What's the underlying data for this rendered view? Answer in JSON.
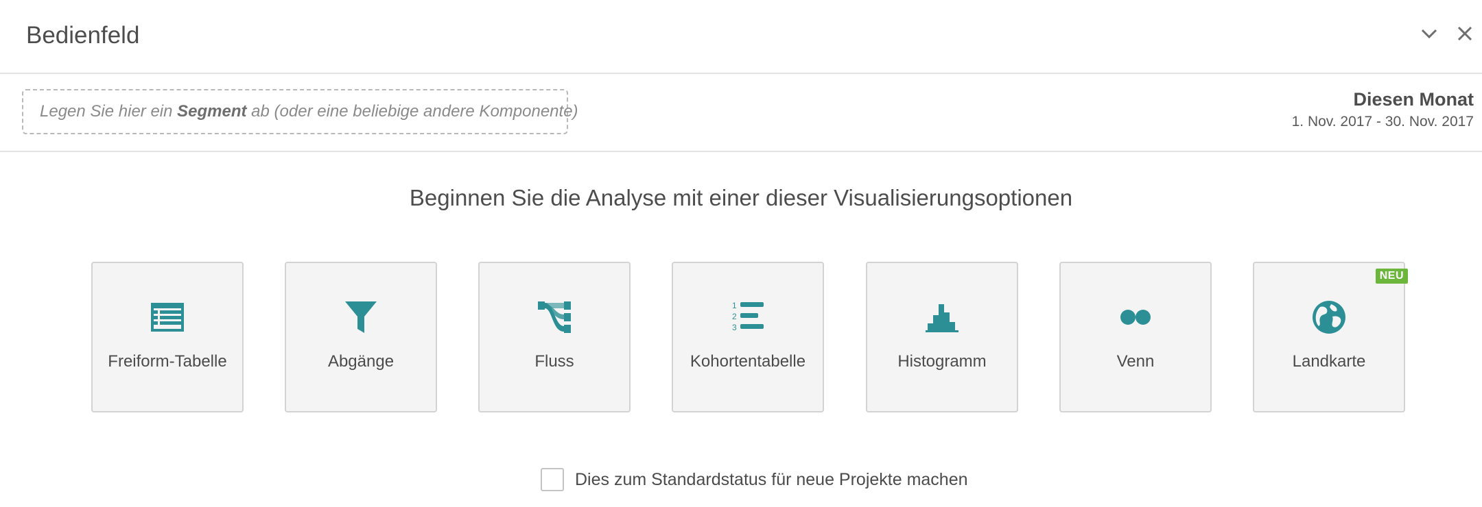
{
  "header": {
    "title": "Bedienfeld",
    "collapse_icon": "chevron-down-icon",
    "close_icon": "close-icon"
  },
  "filter": {
    "dropzone_prefix": "Legen Sie hier ein ",
    "dropzone_bold": "Segment",
    "dropzone_suffix": " ab (oder eine beliebige andere Komponente)",
    "date_name": "Diesen Monat",
    "date_range": "1. Nov. 2017 - 30. Nov. 2017"
  },
  "prompt": "Beginnen Sie die Analyse mit einer dieser Visualisierungsoptionen",
  "visualizations": [
    {
      "label": "Freiform-Tabelle",
      "icon": "table-icon"
    },
    {
      "label": "Abgänge",
      "icon": "funnel-icon"
    },
    {
      "label": "Fluss",
      "icon": "flow-icon"
    },
    {
      "label": "Kohortentabelle",
      "icon": "numbered-list-icon"
    },
    {
      "label": "Histogramm",
      "icon": "histogram-icon"
    },
    {
      "label": "Venn",
      "icon": "venn-icon"
    },
    {
      "label": "Landkarte",
      "icon": "globe-icon",
      "badge": "NEU"
    }
  ],
  "default_checkbox": {
    "label": "Dies zum Standardstatus für neue Projekte machen",
    "checked": false
  },
  "colors": {
    "accent": "#2c8f95",
    "badge": "#6cb63b",
    "card_bg": "#f4f4f4",
    "card_border": "#d3d3d3"
  }
}
